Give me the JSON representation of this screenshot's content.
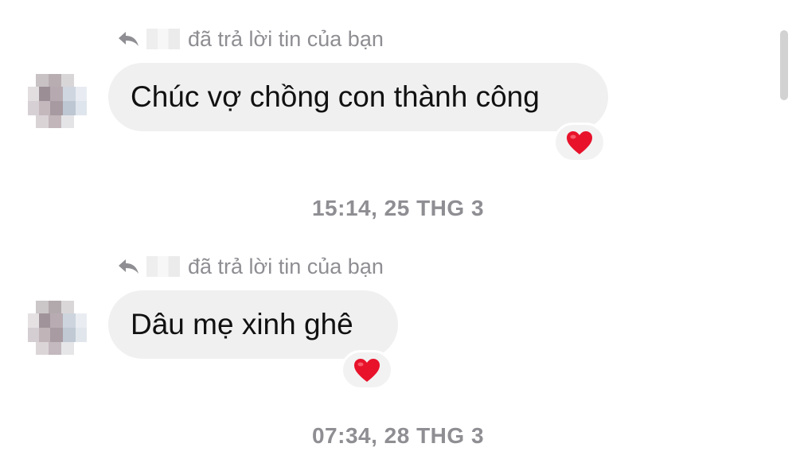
{
  "messages": [
    {
      "reply_label": "đã trả lời tin của bạn",
      "text": "Chúc vợ chồng con thành công",
      "reaction": "red-heart-icon"
    },
    {
      "reply_label": "đã trả lời tin của bạn",
      "text": "Dâu mẹ xinh ghê",
      "reaction": "red-heart-icon"
    }
  ],
  "timestamps": [
    "15:14, 25 THG 3",
    "07:34, 28 THG 3"
  ],
  "colors": {
    "bubble": "#f0f0f0",
    "meta_text": "#8e8e93",
    "heart": "#e8122b"
  }
}
